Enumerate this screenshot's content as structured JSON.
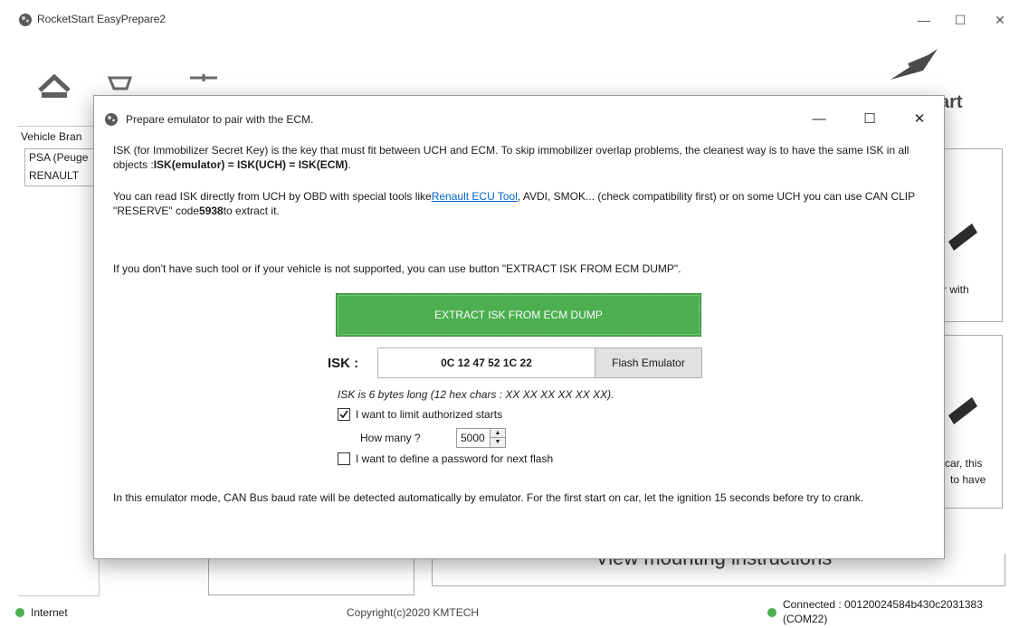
{
  "app": {
    "title": "RocketStart EasyPrepare2",
    "logo_text": "art"
  },
  "left_panel": {
    "header": "Vehicle Bran",
    "brands": [
      "PSA (Peuge",
      "RENAULT"
    ]
  },
  "background": {
    "card_text_1": "r with",
    "card_text_2a": "car, this",
    "card_text_2b": "to have",
    "mounting_button": "View mounting instructions"
  },
  "status_bar": {
    "internet": "Internet",
    "copyright": "Copyright(c)2020 KMTECH",
    "connection_line1": "Connected : 00120024584b430c2031383",
    "connection_line2": "(COM22)"
  },
  "dialog": {
    "title": "Prepare emulator to pair with the ECM.",
    "p1": {
      "a": "ISK (for Immobilizer Secret Key) is the key that must fit between UCH and ECM. To skip immobilizer overlap problems, the cleanest way is to have the same ISK in all objects :",
      "b": "ISK(emulator) = ISK(UCH) = ISK(ECM)",
      "c": "."
    },
    "p2": {
      "a": "You can read ISK directly from UCH by OBD with special tools like",
      "link": "Renault ECU Tool",
      "b": ", AVDI, SMOK... (check compatibility first) or on some UCH you can use CAN CLIP \"RESERVE\" code",
      "code": "5938",
      "c": "to extract it."
    },
    "p3": "If you don't have such tool or if your vehicle is not supported, you can use button \"EXTRACT ISK FROM ECM DUMP\".",
    "extract_button": "EXTRACT ISK FROM ECM DUMP",
    "isk_label": "ISK :",
    "isk_value": "0C 12 47 52 1C 22",
    "flash_button": "Flash Emulator",
    "isk_hint": "ISK is 6 bytes long (12 hex chars : XX XX XX XX XX XX).",
    "limit_starts_label": "I want to limit authorized starts",
    "limit_starts_checked": true,
    "how_many_label": "How many ?",
    "how_many_value": "5000",
    "password_label": "I want to define a password for next flash",
    "password_checked": false,
    "p4": "In this emulator mode, CAN Bus baud rate will be detected automatically by emulator. For the first start on car, let the ignition 15 seconds before try to crank."
  },
  "colors": {
    "accent_green": "#4caf50",
    "link_blue": "#0066cc",
    "status_green": "#4caf50"
  }
}
